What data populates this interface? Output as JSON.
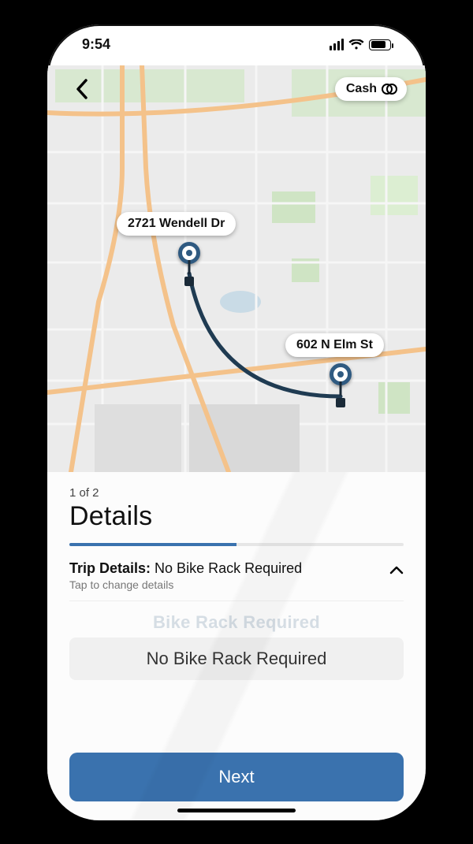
{
  "statusbar": {
    "time": "9:54"
  },
  "map": {
    "payment_label": "Cash",
    "origin_address": "2721 Wendell Dr",
    "destination_address": "602 N Elm St"
  },
  "sheet": {
    "step_counter": "1 of 2",
    "title": "Details",
    "trip_details_label": "Trip Details:",
    "trip_details_value": "No Bike Rack Required",
    "trip_sub": "Tap to change details",
    "picker_ghost": "Bike Rack Required",
    "picker_selected": "No Bike Rack Required",
    "next_label": "Next"
  }
}
